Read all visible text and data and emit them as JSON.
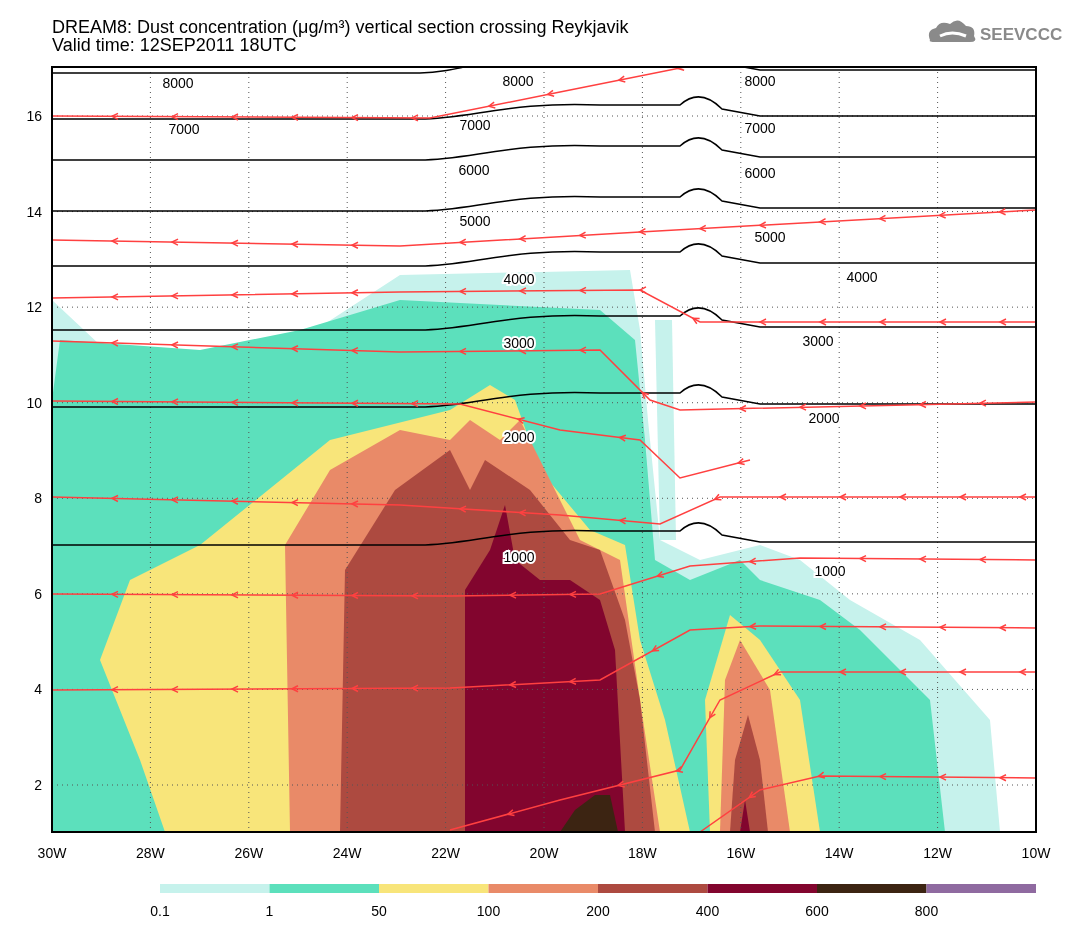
{
  "title": [
    "DREAM8: Dust concentration (μg/m³) vertical section crossing Reykjavik",
    "Valid time: 12SEP2011 18UTC"
  ],
  "logo": {
    "text": "SEEVCCC"
  },
  "plot": {
    "x_tick_labels": [
      "30W",
      "28W",
      "26W",
      "24W",
      "22W",
      "20W",
      "18W",
      "16W",
      "14W",
      "12W",
      "10W"
    ],
    "y_tick_labels": [
      "16",
      "14",
      "12",
      "10",
      "8",
      "6",
      "4",
      "2"
    ],
    "contour_labels": [
      "8000",
      "8000",
      "8000",
      "7000",
      "7000",
      "7000",
      "6000",
      "6000",
      "5000",
      "5000",
      "4000",
      "4000",
      "3000",
      "3000",
      "2000",
      "2000",
      "1000",
      "1000"
    ]
  },
  "colorbar": {
    "bins": [
      {
        "color": "#c6f2ec",
        "label": "0.1"
      },
      {
        "color": "#5ce0bc",
        "label": "1"
      },
      {
        "color": "#f8e57a",
        "label": "50"
      },
      {
        "color": "#e98a68",
        "label": "100"
      },
      {
        "color": "#ad4a40",
        "label": "200"
      },
      {
        "color": "#82052e",
        "label": "400"
      },
      {
        "color": "#3c2412",
        "label": "600"
      },
      {
        "color": "#8f6aa0",
        "label": "800"
      }
    ]
  }
}
